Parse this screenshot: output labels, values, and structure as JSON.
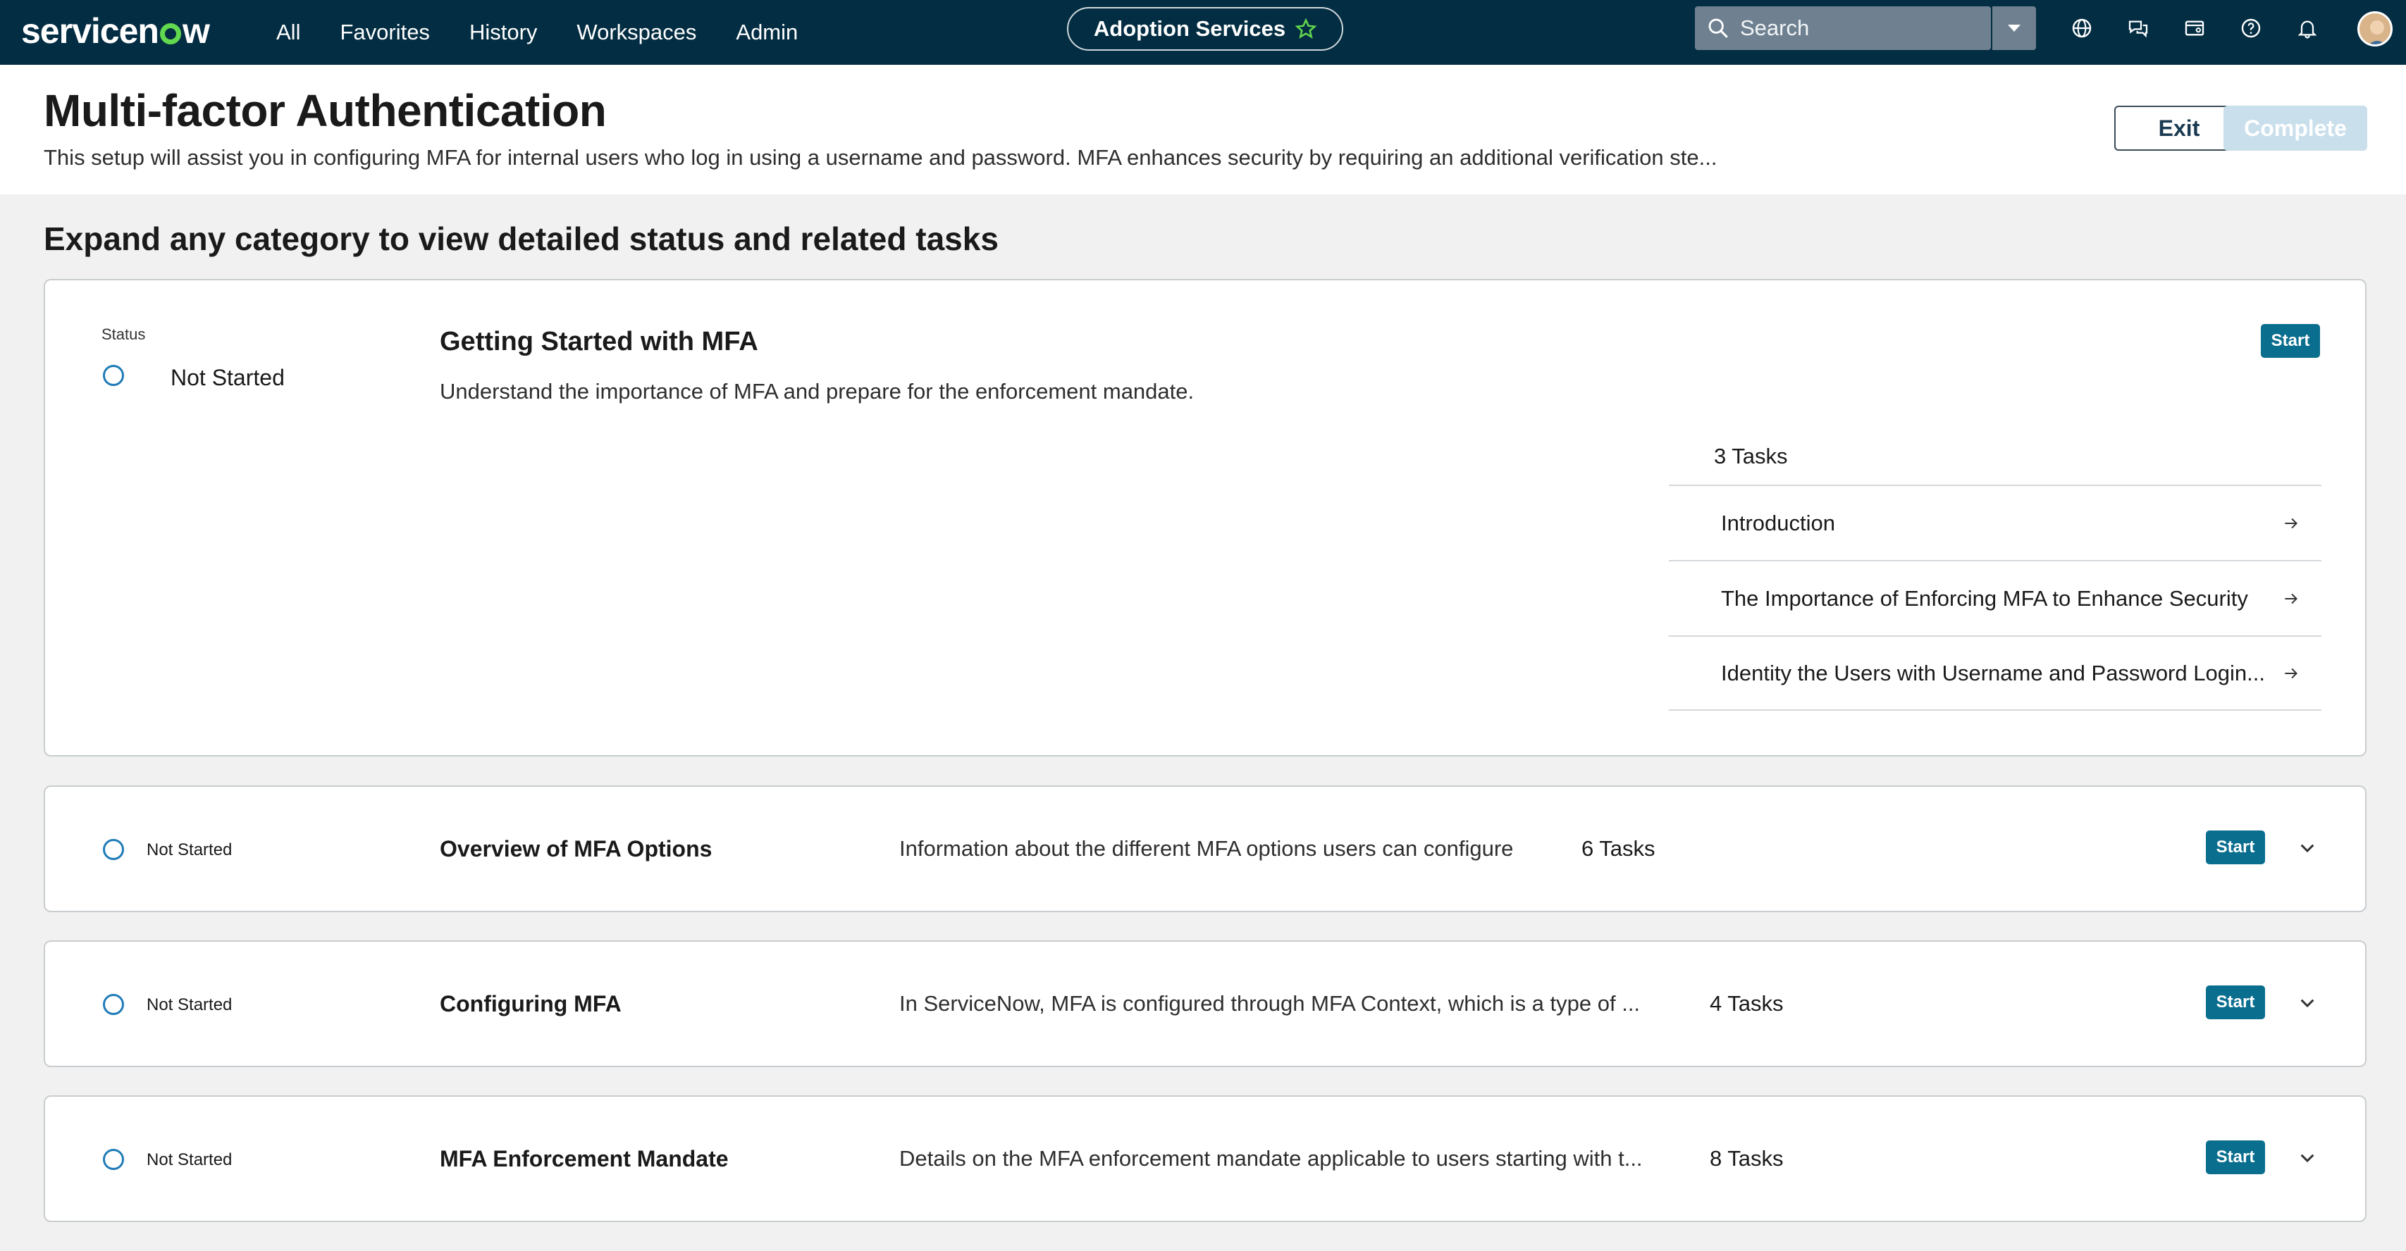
{
  "topnav": {
    "logo": "servicenow",
    "items": [
      "All",
      "Favorites",
      "History",
      "Workspaces",
      "Admin"
    ],
    "workspace": "Adoption Services",
    "search_placeholder": "Search",
    "icons": [
      "globe-icon",
      "chat-icon",
      "card-icon",
      "help-icon",
      "bell-icon"
    ]
  },
  "header": {
    "title": "Multi-factor Authentication",
    "description": "This setup will assist you in configuring MFA for internal users who log in using a username and password. MFA enhances security by requiring an additional verification ste...",
    "exit_label": "Exit",
    "complete_label": "Complete"
  },
  "section": {
    "heading": "Expand any category to view detailed status and related tasks"
  },
  "categories": [
    {
      "status_label": "Status",
      "status": "Not Started",
      "title": "Getting Started with MFA",
      "description": "Understand the importance of MFA and prepare for the enforcement mandate.",
      "start_label": "Start",
      "tasks_count": "3 Tasks",
      "tasks": [
        "Introduction",
        "The Importance of Enforcing MFA to Enhance Security",
        "Identity the Users with Username and Password Login..."
      ]
    },
    {
      "status": "Not Started",
      "title": "Overview of MFA Options",
      "description": "Information about the different MFA options users can configure",
      "tasks_count": "6 Tasks",
      "start_label": "Start"
    },
    {
      "status": "Not Started",
      "title": "Configuring MFA",
      "description": "In ServiceNow, MFA is configured through MFA Context, which is a type of ...",
      "tasks_count": "4 Tasks",
      "start_label": "Start"
    },
    {
      "status": "Not Started",
      "title": "MFA Enforcement Mandate",
      "description": "Details on the MFA enforcement mandate applicable to users starting with t...",
      "tasks_count": "8 Tasks",
      "start_label": "Start"
    }
  ],
  "colors": {
    "nav_bg": "#032d42",
    "accent": "#62d84e",
    "start_button": "#0a6e8e",
    "status_ring": "#1f7bb8",
    "complete_disabled": "#c9dfec"
  }
}
